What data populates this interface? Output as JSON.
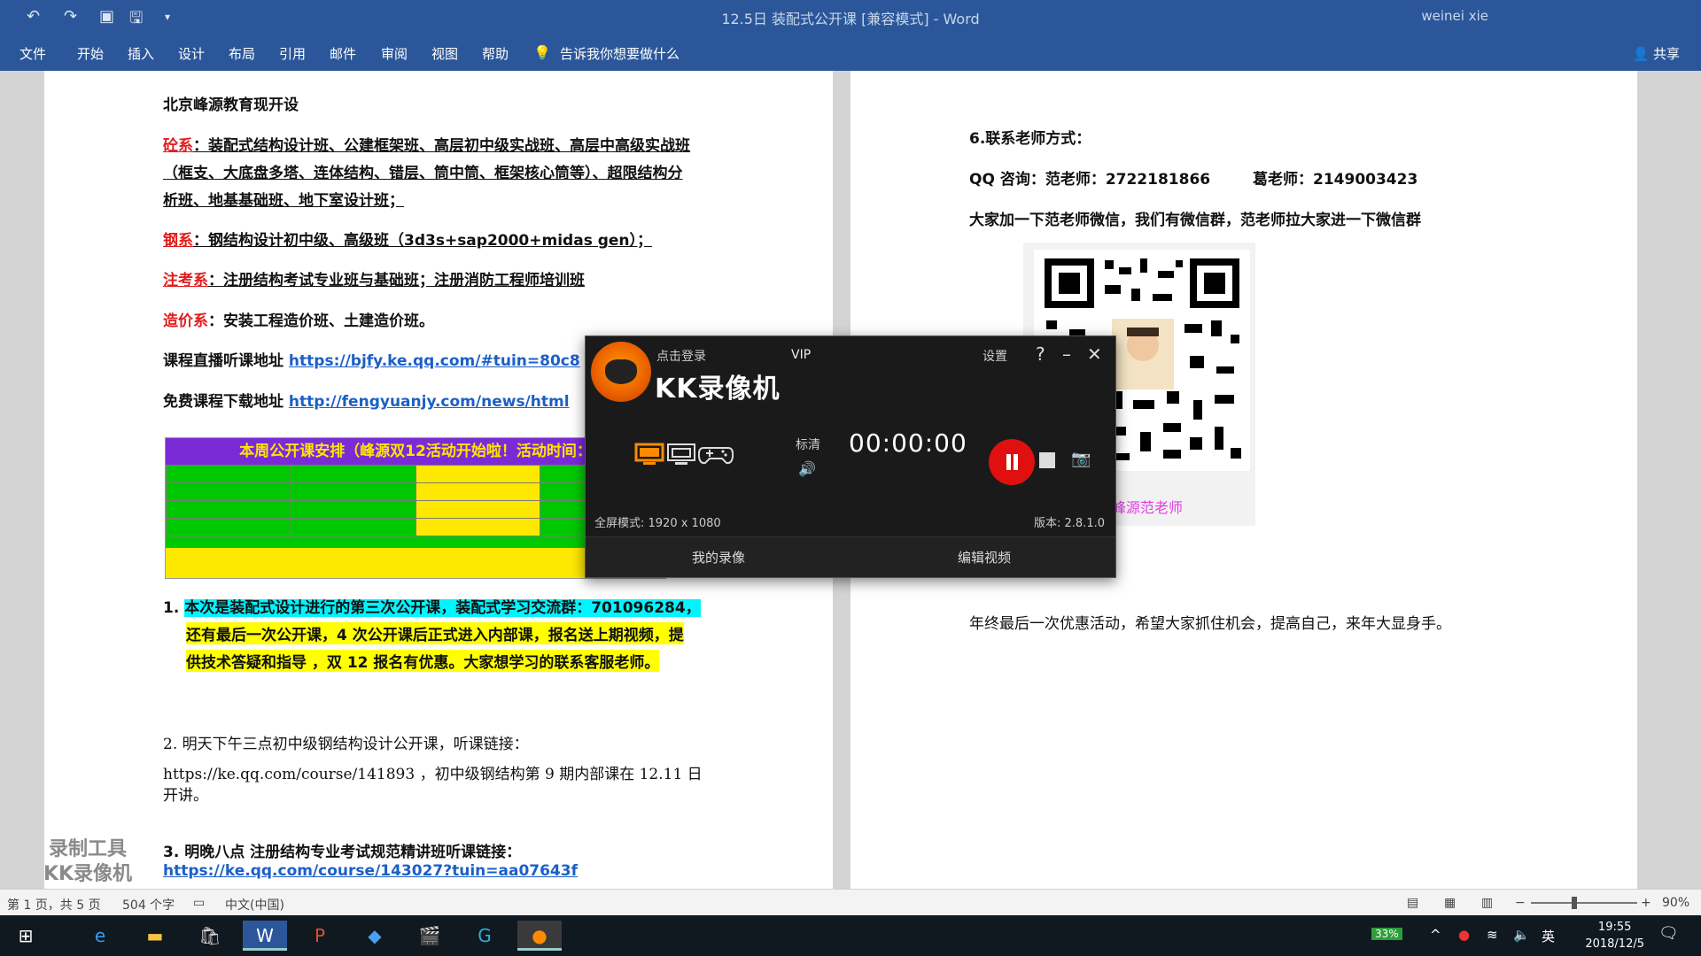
{
  "titlebar": {
    "title": "12.5日 装配式公开课 [兼容模式] - Word",
    "user": "weinei xie",
    "undo": "↶",
    "redo": "↷",
    "save": "🖫"
  },
  "ribbon": {
    "tabs": [
      "文件",
      "开始",
      "插入",
      "设计",
      "布局",
      "引用",
      "邮件",
      "审阅",
      "视图",
      "帮助"
    ],
    "tell_me": "告诉我你想要做什么",
    "share": "共享"
  },
  "page1": {
    "intro": "北京峰源教育现开设",
    "concrete_label": "砼系",
    "concrete_text_1": "：装配式结构设计班、公建框架班、高层初中级实战班、高层中高级实战班",
    "concrete_text_2": "（框支、大底盘多塔、连体结构、错层、筒中筒、框架核心筒等）、超限结构分",
    "concrete_text_3": "析班、地基基础班、地下室设计班；",
    "steel_label": "钢系",
    "steel_text": "：钢结构设计初中级、高级班（3d3s+sap2000+midas gen）；",
    "exam_label": "注考系",
    "exam_text": "：注册结构考试专业班与基础班；注册消防工程师培训班",
    "cost_label": "造价系",
    "cost_text": "：安装工程造价班、土建造价班。",
    "live_label": "课程直播听课地址",
    "live_url": "https://bjfy.ke.qq.com/#tuin=80c8",
    "download_label": "免费课程下载地址",
    "download_url": "http://fengyuanjy.com/news/html",
    "schedule_title": "本周公开课安排（峰源双12活动开始啦！活动时间：",
    "item1_num": "1.",
    "item1_a": "本次是装配式设计进行的第三次公开课，装配式学习交流群：701096284，",
    "item1_b": "还有最后一次公开课，4 次公开课后正式进入内部课，报名送上期视频，提",
    "item1_c": "供技术答疑和指导 ，双 12 报名有优惠。大家想学习的联系客服老师。",
    "item2_title": "2.  明天下午三点初中级钢结构设计公开课，听课链接：",
    "item2_a": "https://ke.qq.com/course/141893 ，初中级钢结构第 9 期内部课在 12.11 日",
    "item2_b": "开讲。",
    "item3_title": "3.  明晚八点 注册结构专业考试规范精讲班听课链接：",
    "item3_url": "https://ke.qq.com/course/143027?tuin=aa07643f"
  },
  "page2": {
    "contact_title": "6.联系老师方式：",
    "qq_line_a": "QQ 咨询：范老师：2722181866",
    "qq_line_b": "葛老师：2149003423",
    "wechat_note": "大家加一下范老师微信，我们有微信群，范老师拉大家进一下微信群",
    "qr_caption": "峰源范老师",
    "final_note": "年终最后一次优惠活动，希望大家抓住机会，提高自己，来年大显身手。"
  },
  "watermark": {
    "line1": "录制工具",
    "line2": "KK录像机"
  },
  "statusbar": {
    "page": "第 1 页，共 5 页",
    "words": "504 个字",
    "language": "中文(中国)",
    "zoom": "90%"
  },
  "kk": {
    "login": "点击登录",
    "vip": "VIP",
    "settings": "设置",
    "brand": "KK录像机",
    "quality": "标清",
    "timer": "00:00:00",
    "fullscreen_mode": "全屏模式: 1920 x 1080",
    "version": "版本: 2.8.1.0",
    "my_recordings": "我的录像",
    "edit_video": "编辑视频"
  },
  "taskbar": {
    "time": "19:55",
    "date": "2018/12/5",
    "ime": "英",
    "battery": "33%"
  },
  "colors": {
    "word_blue": "#2b579a",
    "red": "#e31b1b",
    "link": "#1c5fc8",
    "highlight": "#ffff00"
  }
}
